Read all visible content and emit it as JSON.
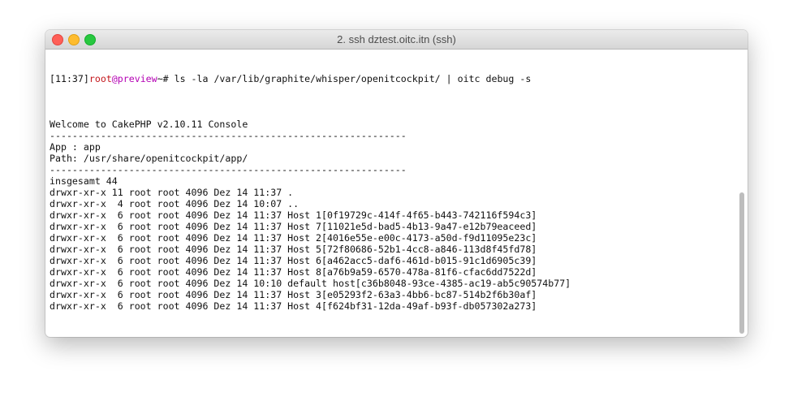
{
  "window": {
    "title": "2. ssh dztest.oitc.itn (ssh)"
  },
  "terminal": {
    "prompt": {
      "time": "[11:37]",
      "user": "root",
      "at_host": "@preview",
      "path_symbol": "~# "
    },
    "command": "ls -la /var/lib/graphite/whisper/openitcockpit/ | oitc debug -s",
    "lines": [
      "",
      "Welcome to CakePHP v2.10.11 Console",
      "---------------------------------------------------------------",
      "App : app",
      "Path: /usr/share/openitcockpit/app/",
      "---------------------------------------------------------------",
      "insgesamt 44",
      "drwxr-xr-x 11 root root 4096 Dez 14 11:37 .",
      "drwxr-xr-x  4 root root 4096 Dez 14 10:07 ..",
      "drwxr-xr-x  6 root root 4096 Dez 14 11:37 Host 1[0f19729c-414f-4f65-b443-742116f594c3]",
      "drwxr-xr-x  6 root root 4096 Dez 14 11:37 Host 7[11021e5d-bad5-4b13-9a47-e12b79eaceed]",
      "drwxr-xr-x  6 root root 4096 Dez 14 11:37 Host 2[4016e55e-e00c-4173-a50d-f9d11095e23c]",
      "drwxr-xr-x  6 root root 4096 Dez 14 11:37 Host 5[72f80686-52b1-4cc8-a846-113d8f45fd78]",
      "drwxr-xr-x  6 root root 4096 Dez 14 11:37 Host 6[a462acc5-daf6-461d-b015-91c1d6905c39]",
      "drwxr-xr-x  6 root root 4096 Dez 14 11:37 Host 8[a76b9a59-6570-478a-81f6-cfac6dd7522d]",
      "drwxr-xr-x  6 root root 4096 Dez 14 10:10 default host[c36b8048-93ce-4385-ac19-ab5c90574b77]",
      "drwxr-xr-x  6 root root 4096 Dez 14 11:37 Host 3[e05293f2-63a3-4bb6-bc87-514b2f6b30af]",
      "drwxr-xr-x  6 root root 4096 Dez 14 11:37 Host 4[f624bf31-12da-49af-b93f-db057302a273]",
      ""
    ]
  },
  "colors": {
    "user": "#c4171c",
    "host": "#b400b4",
    "text": "#111111"
  }
}
